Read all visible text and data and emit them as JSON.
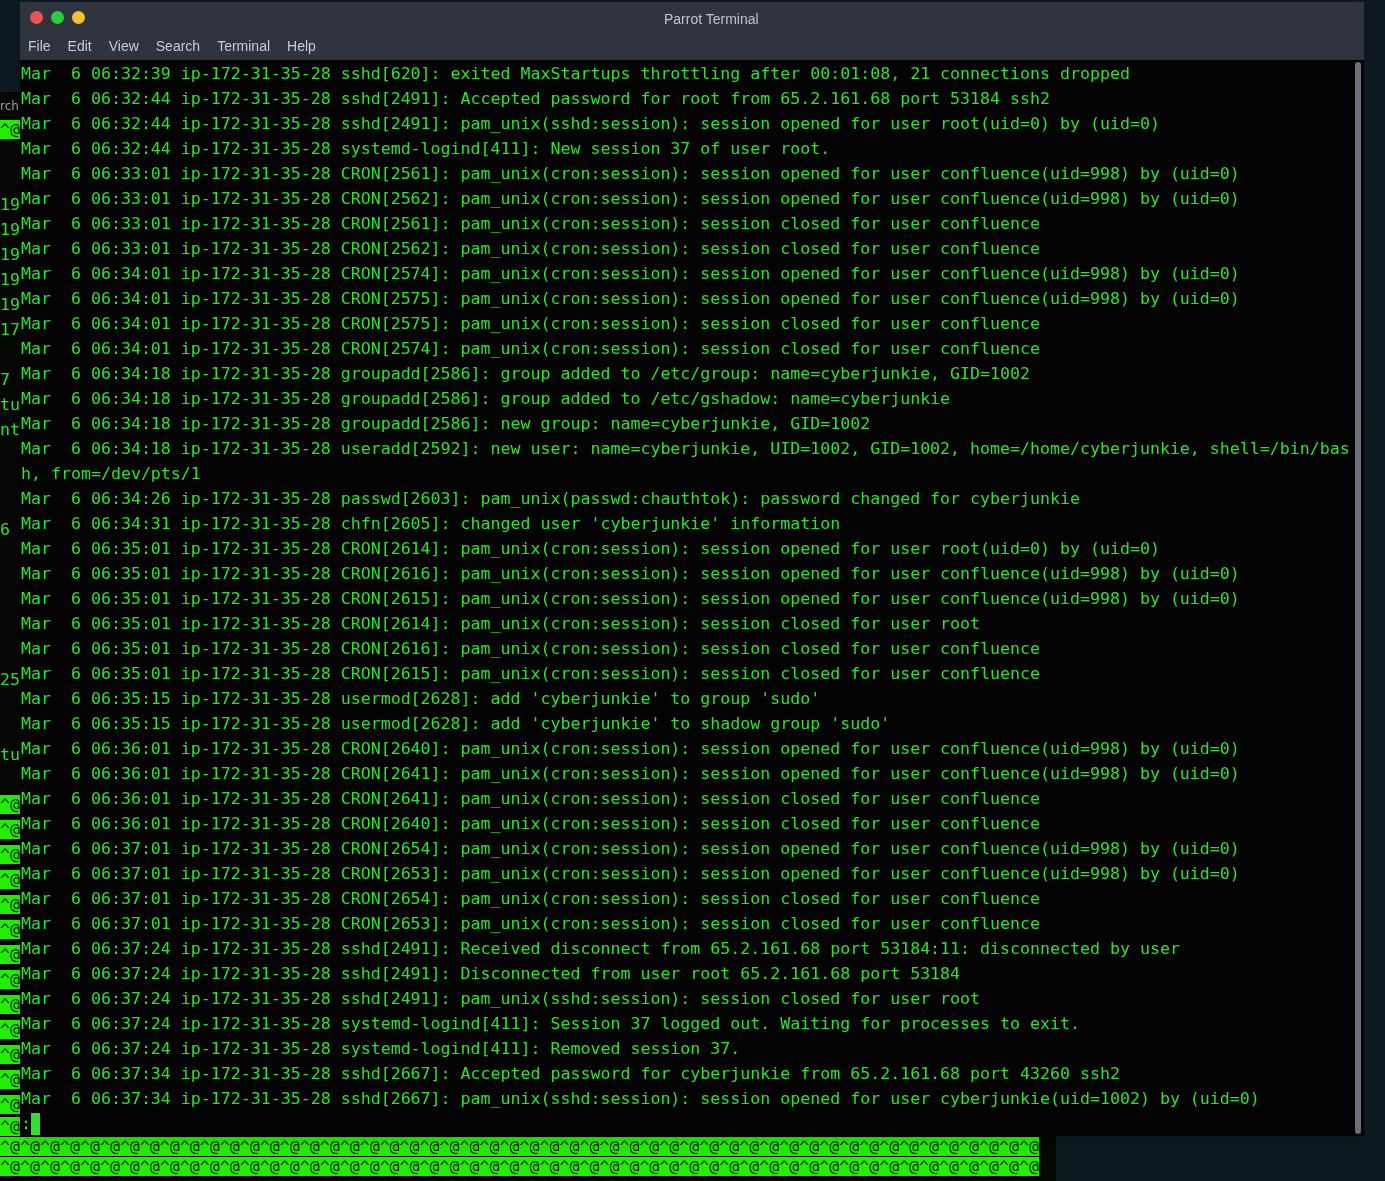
{
  "background_terminal": {
    "rows": [
      {
        "kind": "menu",
        "text": "rch"
      },
      {
        "kind": "line",
        "text": "^@",
        "highlighted": true
      },
      {
        "kind": "line"
      },
      {
        "kind": "line"
      },
      {
        "kind": "line",
        "text": "19",
        "highlighted": false
      },
      {
        "kind": "line",
        "text": "19",
        "highlighted": false
      },
      {
        "kind": "line",
        "text": "19",
        "highlighted": false
      },
      {
        "kind": "line",
        "text": "19",
        "highlighted": false
      },
      {
        "kind": "line",
        "text": "19",
        "highlighted": false
      },
      {
        "kind": "line",
        "text": "17",
        "highlighted": false
      },
      {
        "kind": "line"
      },
      {
        "kind": "line",
        "text": "7",
        "highlighted": false
      },
      {
        "kind": "line",
        "text": "tu",
        "highlighted": false
      },
      {
        "kind": "line",
        "text": "nt",
        "highlighted": false
      },
      {
        "kind": "line"
      },
      {
        "kind": "line"
      },
      {
        "kind": "line"
      },
      {
        "kind": "line",
        "text": "6",
        "highlighted": false
      },
      {
        "kind": "line"
      },
      {
        "kind": "line"
      },
      {
        "kind": "line"
      },
      {
        "kind": "line"
      },
      {
        "kind": "line"
      },
      {
        "kind": "line",
        "text": "25",
        "highlighted": false
      },
      {
        "kind": "line"
      },
      {
        "kind": "line"
      },
      {
        "kind": "line",
        "text": "tu",
        "highlighted": false
      },
      {
        "kind": "line"
      },
      {
        "kind": "line",
        "text": "^@",
        "highlighted": true
      },
      {
        "kind": "line",
        "text": "^@",
        "highlighted": true
      },
      {
        "kind": "line",
        "text": "^@",
        "highlighted": true
      },
      {
        "kind": "line",
        "text": "^@",
        "highlighted": true
      },
      {
        "kind": "line",
        "text": "^@",
        "highlighted": true
      },
      {
        "kind": "line",
        "text": "^@",
        "highlighted": true
      },
      {
        "kind": "line",
        "text": "^@",
        "highlighted": true
      },
      {
        "kind": "line",
        "text": "^@",
        "highlighted": true
      },
      {
        "kind": "line",
        "text": "^@",
        "highlighted": true
      },
      {
        "kind": "line",
        "text": "^@",
        "highlighted": true
      },
      {
        "kind": "line",
        "text": "^@",
        "highlighted": true
      },
      {
        "kind": "line",
        "text": "^@",
        "highlighted": true
      },
      {
        "kind": "line",
        "text": "^@",
        "highlighted": true
      },
      {
        "kind": "band",
        "text": "^@",
        "highlighted": true
      },
      {
        "kind": "band",
        "text": "^@^@^@^@^@^@^@^@^@^@^@^@^@^@^@^@^@^@^@^@^@^@^@^@^@^@^@^@^@^@^@^@^@^@^@^@^@^@^@^@^@^@^@^@^@^@^@^@^@^@^@^@",
        "highlighted": true
      },
      {
        "kind": "band",
        "text": "^@^@^@^@^@^@^@^@^@^@^@^@^@^@^@^@^@^@^@^@^@^@^@^@^@^@^@^@^@^@^@^@^@^@^@^@^@^@^@^@^@^@^@^@^@^@^@^@^@^@^@^@",
        "highlighted": true
      }
    ]
  },
  "window": {
    "title": "Parrot Terminal",
    "menu": [
      "File",
      "Edit",
      "View",
      "Search",
      "Terminal",
      "Help"
    ]
  },
  "terminal": {
    "lines": [
      "Mar  6 06:32:39 ip-172-31-35-28 sshd[620]: exited MaxStartups throttling after 00:01:08, 21 connections dropped",
      "Mar  6 06:32:44 ip-172-31-35-28 sshd[2491]: Accepted password for root from 65.2.161.68 port 53184 ssh2",
      "Mar  6 06:32:44 ip-172-31-35-28 sshd[2491]: pam_unix(sshd:session): session opened for user root(uid=0) by (uid=0)",
      "Mar  6 06:32:44 ip-172-31-35-28 systemd-logind[411]: New session 37 of user root.",
      "Mar  6 06:33:01 ip-172-31-35-28 CRON[2561]: pam_unix(cron:session): session opened for user confluence(uid=998) by (uid=0)",
      "Mar  6 06:33:01 ip-172-31-35-28 CRON[2562]: pam_unix(cron:session): session opened for user confluence(uid=998) by (uid=0)",
      "Mar  6 06:33:01 ip-172-31-35-28 CRON[2561]: pam_unix(cron:session): session closed for user confluence",
      "Mar  6 06:33:01 ip-172-31-35-28 CRON[2562]: pam_unix(cron:session): session closed for user confluence",
      "Mar  6 06:34:01 ip-172-31-35-28 CRON[2574]: pam_unix(cron:session): session opened for user confluence(uid=998) by (uid=0)",
      "Mar  6 06:34:01 ip-172-31-35-28 CRON[2575]: pam_unix(cron:session): session opened for user confluence(uid=998) by (uid=0)",
      "Mar  6 06:34:01 ip-172-31-35-28 CRON[2575]: pam_unix(cron:session): session closed for user confluence",
      "Mar  6 06:34:01 ip-172-31-35-28 CRON[2574]: pam_unix(cron:session): session closed for user confluence",
      "Mar  6 06:34:18 ip-172-31-35-28 groupadd[2586]: group added to /etc/group: name=cyberjunkie, GID=1002",
      "Mar  6 06:34:18 ip-172-31-35-28 groupadd[2586]: group added to /etc/gshadow: name=cyberjunkie",
      "Mar  6 06:34:18 ip-172-31-35-28 groupadd[2586]: new group: name=cyberjunkie, GID=1002",
      "Mar  6 06:34:18 ip-172-31-35-28 useradd[2592]: new user: name=cyberjunkie, UID=1002, GID=1002, home=/home/cyberjunkie, shell=/bin/bas",
      "h, from=/dev/pts/1",
      "Mar  6 06:34:26 ip-172-31-35-28 passwd[2603]: pam_unix(passwd:chauthtok): password changed for cyberjunkie",
      "Mar  6 06:34:31 ip-172-31-35-28 chfn[2605]: changed user 'cyberjunkie' information",
      "Mar  6 06:35:01 ip-172-31-35-28 CRON[2614]: pam_unix(cron:session): session opened for user root(uid=0) by (uid=0)",
      "Mar  6 06:35:01 ip-172-31-35-28 CRON[2616]: pam_unix(cron:session): session opened for user confluence(uid=998) by (uid=0)",
      "Mar  6 06:35:01 ip-172-31-35-28 CRON[2615]: pam_unix(cron:session): session opened for user confluence(uid=998) by (uid=0)",
      "Mar  6 06:35:01 ip-172-31-35-28 CRON[2614]: pam_unix(cron:session): session closed for user root",
      "Mar  6 06:35:01 ip-172-31-35-28 CRON[2616]: pam_unix(cron:session): session closed for user confluence",
      "Mar  6 06:35:01 ip-172-31-35-28 CRON[2615]: pam_unix(cron:session): session closed for user confluence",
      "Mar  6 06:35:15 ip-172-31-35-28 usermod[2628]: add 'cyberjunkie' to group 'sudo'",
      "Mar  6 06:35:15 ip-172-31-35-28 usermod[2628]: add 'cyberjunkie' to shadow group 'sudo'",
      "Mar  6 06:36:01 ip-172-31-35-28 CRON[2640]: pam_unix(cron:session): session opened for user confluence(uid=998) by (uid=0)",
      "Mar  6 06:36:01 ip-172-31-35-28 CRON[2641]: pam_unix(cron:session): session opened for user confluence(uid=998) by (uid=0)",
      "Mar  6 06:36:01 ip-172-31-35-28 CRON[2641]: pam_unix(cron:session): session closed for user confluence",
      "Mar  6 06:36:01 ip-172-31-35-28 CRON[2640]: pam_unix(cron:session): session closed for user confluence",
      "Mar  6 06:37:01 ip-172-31-35-28 CRON[2654]: pam_unix(cron:session): session opened for user confluence(uid=998) by (uid=0)",
      "Mar  6 06:37:01 ip-172-31-35-28 CRON[2653]: pam_unix(cron:session): session opened for user confluence(uid=998) by (uid=0)",
      "Mar  6 06:37:01 ip-172-31-35-28 CRON[2654]: pam_unix(cron:session): session closed for user confluence",
      "Mar  6 06:37:01 ip-172-31-35-28 CRON[2653]: pam_unix(cron:session): session closed for user confluence",
      "Mar  6 06:37:24 ip-172-31-35-28 sshd[2491]: Received disconnect from 65.2.161.68 port 53184:11: disconnected by user",
      "Mar  6 06:37:24 ip-172-31-35-28 sshd[2491]: Disconnected from user root 65.2.161.68 port 53184",
      "Mar  6 06:37:24 ip-172-31-35-28 sshd[2491]: pam_unix(sshd:session): session closed for user root",
      "Mar  6 06:37:24 ip-172-31-35-28 systemd-logind[411]: Session 37 logged out. Waiting for processes to exit.",
      "Mar  6 06:37:24 ip-172-31-35-28 systemd-logind[411]: Removed session 37.",
      "Mar  6 06:37:34 ip-172-31-35-28 sshd[2667]: Accepted password for cyberjunkie from 65.2.161.68 port 43260 ssh2",
      "Mar  6 06:37:34 ip-172-31-35-28 sshd[2667]: pam_unix(sshd:session): session opened for user cyberjunkie(uid=1002) by (uid=0)"
    ],
    "prompt": ":"
  }
}
